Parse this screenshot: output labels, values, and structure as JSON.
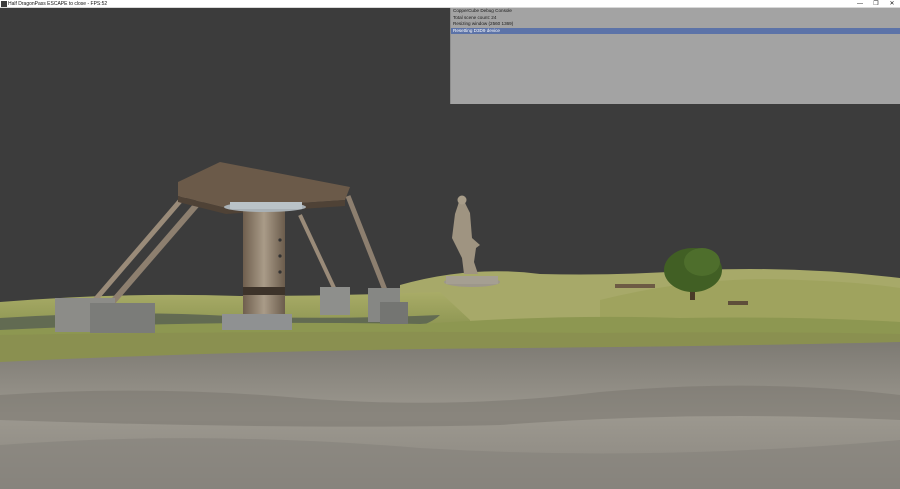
{
  "window": {
    "title": "Half DragonPass ESCAPE to close - FPS:52",
    "minimize_icon": "minimize-icon",
    "maximize_icon": "maximize-icon",
    "close_icon": "close-icon",
    "minimize_glyph": "—",
    "maximize_glyph": "❐",
    "close_glyph": "✕"
  },
  "console": {
    "lines": [
      {
        "text": "CopperCube Debug Console",
        "selected": false
      },
      {
        "text": "Total scene count: 24",
        "selected": false
      },
      {
        "text": "Resizing window (2560 1369)",
        "selected": false
      },
      {
        "text": "Resetting D3D9 device",
        "selected": true
      }
    ]
  },
  "colors": {
    "sky": "#3c3c3c",
    "grass": "#9aa05c",
    "rock": "#8e8b85",
    "console_bg": "#a3a3a3",
    "console_highlight": "#5c73a8"
  }
}
